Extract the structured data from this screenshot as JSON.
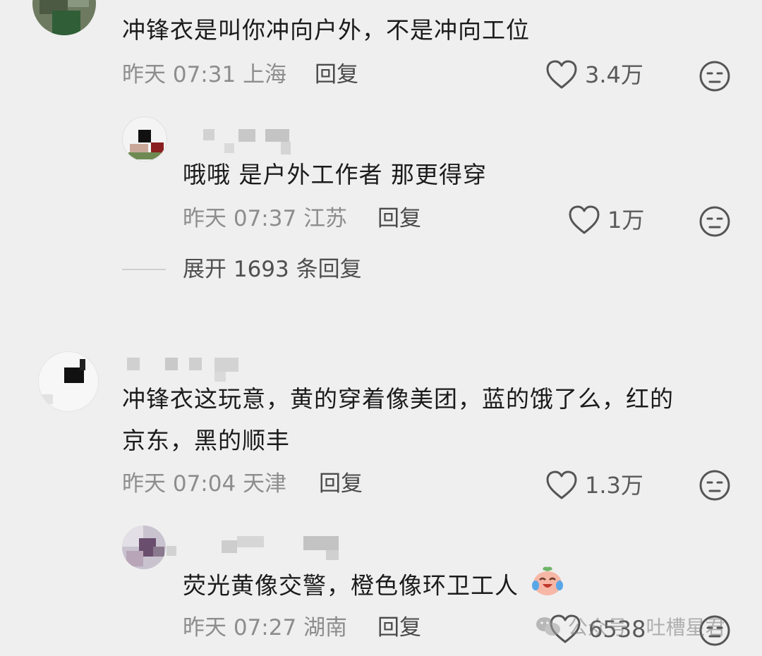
{
  "comments": [
    {
      "text": "冲锋衣是叫你冲向户外，不是冲向工位",
      "time": "昨天 07:31",
      "location": "上海",
      "reply_label": "回复",
      "likes": "3.4万"
    },
    {
      "text": "哦哦 是户外工作者 那更得穿",
      "time": "昨天 07:37",
      "location": "江苏",
      "reply_label": "回复",
      "likes": "1万"
    },
    {
      "text_line1": "冲锋衣这玩意，黄的穿着像美团，蓝的饿了么，红的",
      "text_line2": "京东，黑的顺丰",
      "time": "昨天 07:04",
      "location": "天津",
      "reply_label": "回复",
      "likes": "1.3万"
    },
    {
      "text": "荧光黄像交警，橙色像环卫工人",
      "time": "昨天 07:27",
      "location": "湖南",
      "reply_label": "回复",
      "likes": "6538"
    }
  ],
  "expand_replies": "展开 1693 条回复",
  "watermark": "公众号 · 吐槽星君",
  "icons": {
    "like": "heart-outline-icon",
    "dislike": "meh-face-icon",
    "emoji": "laughing-crying-emoji",
    "watermark": "wechat-icon"
  }
}
